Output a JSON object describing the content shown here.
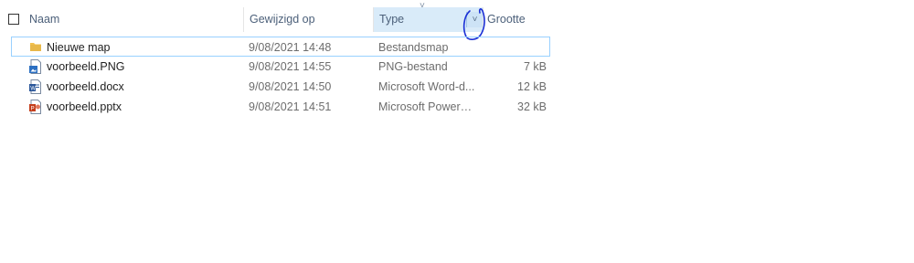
{
  "columns": {
    "name": "Naam",
    "modified": "Gewijzigd op",
    "type": "Type",
    "size": "Grootte"
  },
  "sort_arrow": "˅",
  "filter_glyph": "˅",
  "files": [
    {
      "name": "Nieuwe map",
      "modified": "9/08/2021 14:48",
      "type": "Bestandsmap",
      "size": "",
      "icon": "folder-icon",
      "color": "#e8b84a"
    },
    {
      "name": "voorbeeld.PNG",
      "modified": "9/08/2021 14:55",
      "type": "PNG-bestand",
      "size": "7 kB",
      "icon": "image-file-icon",
      "color": "#2b6fc2"
    },
    {
      "name": "voorbeeld.docx",
      "modified": "9/08/2021 14:50",
      "type": "Microsoft Word-d...",
      "size": "12 kB",
      "icon": "word-file-icon",
      "color": "#2b579a"
    },
    {
      "name": "voorbeeld.pptx",
      "modified": "9/08/2021 14:51",
      "type": "Microsoft PowerPo...",
      "size": "32 kB",
      "icon": "powerpoint-file-icon",
      "color": "#c43e1c"
    }
  ],
  "colors": {
    "header_text": "#4c607a",
    "sorted_column_bg": "#d9ebf9",
    "selection_border": "#99d1ff",
    "annotation_ink": "#1a2fd6"
  }
}
